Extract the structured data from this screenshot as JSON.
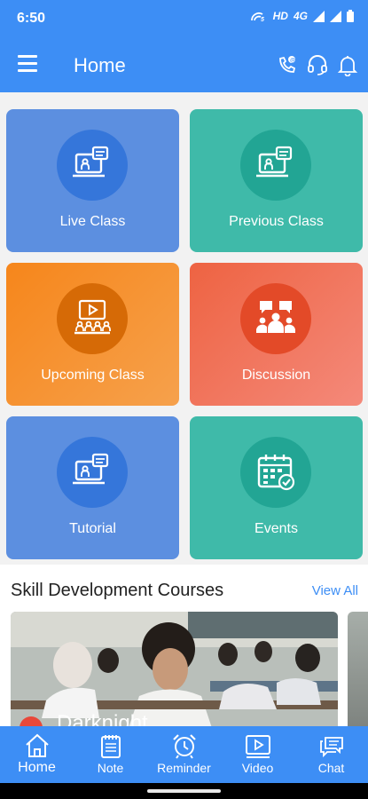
{
  "status_bar": {
    "time": "6:50",
    "network": "HD",
    "signal_label": "4G"
  },
  "app_bar": {
    "title": "Home",
    "actions": [
      "call-support-icon",
      "headset-icon",
      "bell-icon"
    ]
  },
  "tiles": [
    {
      "label": "Live Class",
      "icon": "laptop-classroom-icon",
      "color": "#5c8fe0"
    },
    {
      "label": "Previous Class",
      "icon": "laptop-classroom-icon",
      "color": "#3fbaa9"
    },
    {
      "label": "Upcoming Class",
      "icon": "video-classroom-icon",
      "color": "#f6861b"
    },
    {
      "label": "Discussion",
      "icon": "discussion-group-icon",
      "color": "#ee6342"
    },
    {
      "label": "Tutorial",
      "icon": "laptop-classroom-icon",
      "color": "#5c8fe0"
    },
    {
      "label": "Events",
      "icon": "calendar-check-icon",
      "color": "#3fbaa9"
    }
  ],
  "courses_section": {
    "title": "Skill Development Courses",
    "view_all": "View All",
    "cards": [
      {
        "name": "Darknight"
      }
    ]
  },
  "bottom_nav": {
    "items": [
      {
        "label": "Home",
        "icon": "home-icon",
        "active": true
      },
      {
        "label": "Note",
        "icon": "note-icon",
        "active": false
      },
      {
        "label": "Reminder",
        "icon": "alarm-clock-icon",
        "active": false
      },
      {
        "label": "Video",
        "icon": "video-icon",
        "active": false
      },
      {
        "label": "Chat",
        "icon": "chat-icon",
        "active": false
      }
    ]
  },
  "colors": {
    "primary": "#3d8ef5",
    "blue_tile": "#5c8fe0",
    "teal_tile": "#3fbaa9",
    "orange_tile": "#f6861b",
    "red_tile": "#ee6342"
  }
}
